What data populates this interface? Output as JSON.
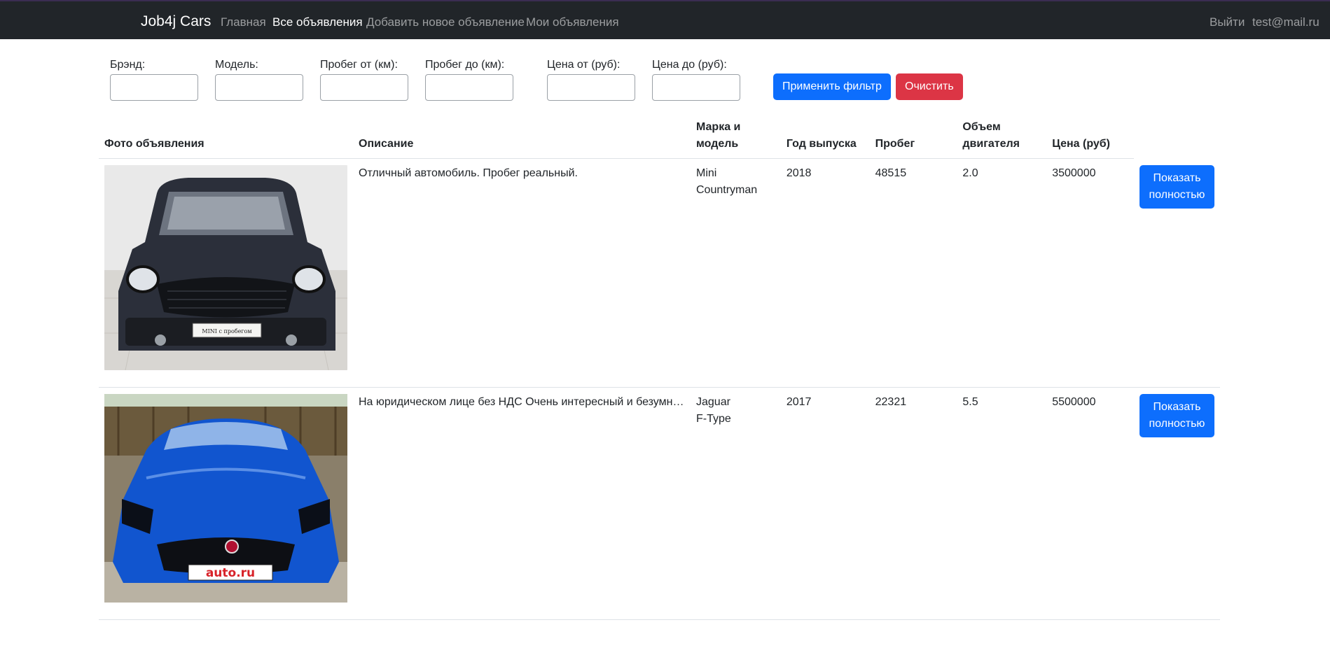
{
  "nav": {
    "brand": "Job4j Cars",
    "links": [
      "Главная",
      "Все объявления",
      "Добавить новое объявление",
      "Мои объявления"
    ],
    "logout": "Выйти",
    "user": "test@mail.ru"
  },
  "filters": {
    "brand_label": "Брэнд:",
    "model_label": "Модель:",
    "mileage_from_label": "Пробег от (км):",
    "mileage_to_label": "Пробег до (км):",
    "price_from_label": "Цена от (руб):",
    "price_to_label": "Цена до (руб):",
    "apply": "Применить фильтр",
    "clear": "Очистить"
  },
  "table": {
    "headers": [
      "Фото объявления",
      "Описание",
      "Марка и модель",
      "Год выпуска",
      "Пробег",
      "Объем двигателя",
      "Цена (руб)"
    ],
    "rows": [
      {
        "description": "Отличный автомобиль. Пробег реальный.",
        "make": "Mini",
        "model": "Countryman",
        "year": "2018",
        "mileage": "48515",
        "engine": "2.0",
        "price": "3500000",
        "plate": "MINI с пробегом",
        "button": "Показать полностью"
      },
      {
        "description": "На юридическом лице без НДС Очень интересный и безумно красивый автомобиль",
        "make": "Jaguar",
        "model": "F-Type",
        "year": "2017",
        "mileage": "22321",
        "engine": "5.5",
        "price": "5500000",
        "plate": "auto.ru",
        "button": "Показать полностью"
      }
    ]
  }
}
